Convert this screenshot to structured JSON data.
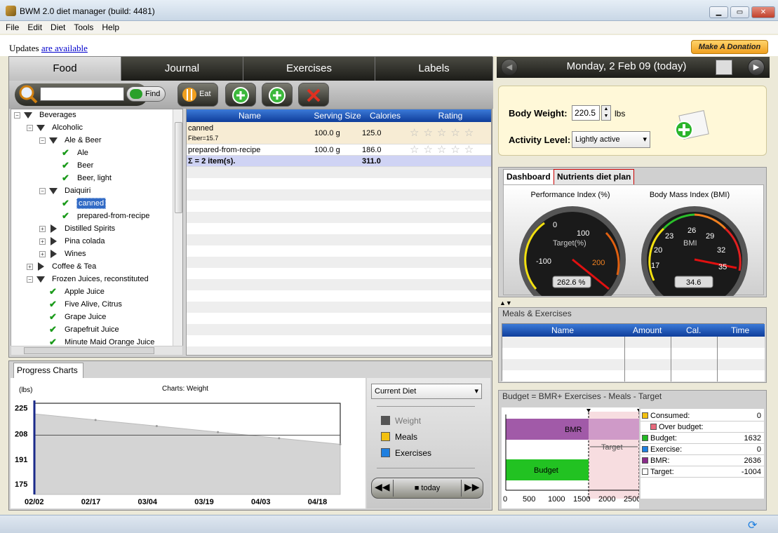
{
  "window": {
    "title": "BWM 2.0 diet manager (build: 4481)"
  },
  "menu": [
    "File",
    "Edit",
    "Diet",
    "Tools",
    "Help"
  ],
  "updates": {
    "prefix": "Updates",
    "link": "are available"
  },
  "donate_label": "Make A Donation",
  "tabs": [
    "Food",
    "Journal",
    "Exercises",
    "Labels"
  ],
  "toolbar": {
    "find_label": "Find",
    "eat_label": "Eat",
    "search_value": ""
  },
  "tree": {
    "beverages": "Beverages",
    "alcoholic": "Alcoholic",
    "ale_beer": "Ale & Beer",
    "ale": "Ale",
    "beer": "Beer",
    "beer_light": "Beer, light",
    "daiquiri": "Daiquiri",
    "canned": "canned",
    "prepared": "prepared-from-recipe",
    "distilled": "Distilled Spirits",
    "pina": "Pina colada",
    "wines": "Wines",
    "coffee": "Coffee & Tea",
    "frozen": "Frozen Juices, reconstituted",
    "apple": "Apple Juice",
    "fivealive": "Five Alive, Citrus",
    "grape": "Grape Juice",
    "grapefruit": "Grapefruit Juice",
    "minute": "Minute Maid Orange Juice"
  },
  "grid": {
    "headers": {
      "name": "Name",
      "serving": "Serving Size",
      "calories": "Calories",
      "rating": "Rating"
    },
    "rows": [
      {
        "name": "canned",
        "sub": "Fiber=15.7",
        "serving": "100.0 g",
        "calories": "125.0"
      },
      {
        "name": "prepared-from-recipe",
        "serving": "100.0 g",
        "calories": "186.0"
      }
    ],
    "sum": {
      "label": "Σ = 2 item(s).",
      "calories": "311.0"
    }
  },
  "progress": {
    "tab": "Progress Charts",
    "diet_select": "Current Diet",
    "legend": [
      {
        "label": "Weight",
        "color": "#555555"
      },
      {
        "label": "Meals",
        "color": "#f2c010"
      },
      {
        "label": "Exercises",
        "color": "#1e7fe0"
      }
    ],
    "today_label": "today"
  },
  "chart_data": {
    "type": "area",
    "title": "Charts: Weight",
    "ylabel": "(lbs)",
    "ylim": [
      168,
      228
    ],
    "yticks": [
      225,
      208,
      191,
      175
    ],
    "x": [
      "02/02",
      "02/17",
      "03/04",
      "03/19",
      "04/03",
      "04/18"
    ],
    "series": [
      {
        "name": "Weight",
        "values": [
          221,
          217,
          213,
          209,
          205,
          201
        ]
      }
    ],
    "target": 207,
    "grid": false
  },
  "date": "Monday, 2 Feb 09 (today)",
  "body": {
    "weight_label": "Body Weight:",
    "weight_value": "220.5",
    "weight_unit": "lbs",
    "activity_label": "Activity Level:",
    "activity_value": "Lightly active"
  },
  "dash": {
    "tabs": [
      "Dashboard",
      "Nutrients diet plan"
    ],
    "gauge1": {
      "title": "Performance Index (%)",
      "value": "262.6 %",
      "label": "Target(%)",
      "ticks": [
        "-100",
        "0",
        "100",
        "200"
      ]
    },
    "gauge2": {
      "title": "Body Mass Index (BMI)",
      "value": "34.6",
      "label": "BMI",
      "ticks": [
        "17",
        "20",
        "23",
        "26",
        "29",
        "32",
        "35"
      ]
    }
  },
  "meals": {
    "title": "Meals & Exercises",
    "headers": [
      "Name",
      "Amount",
      "Cal.",
      "Time"
    ]
  },
  "budget": {
    "title": "Budget = BMR+ Exercises - Meals - Target",
    "bmr_label": "BMR",
    "budget_label": "Budget",
    "target_label": "Target",
    "xticks": [
      "0",
      "500",
      "1000",
      "1500",
      "2000",
      "2500"
    ],
    "legend": [
      {
        "label": "Consumed:",
        "value": "0",
        "color": "#f2c010"
      },
      {
        "label": "Over budget:",
        "value": "",
        "color": "#e86a7c"
      },
      {
        "label": "Budget:",
        "value": "1632",
        "color": "#22b822"
      },
      {
        "label": "Exercise:",
        "value": "0",
        "color": "#1e7fe0"
      },
      {
        "label": "BMR:",
        "value": "2636",
        "color": "#8a2a8a"
      },
      {
        "label": "Target:",
        "value": "-1004",
        "color": "#ffffff"
      }
    ]
  }
}
